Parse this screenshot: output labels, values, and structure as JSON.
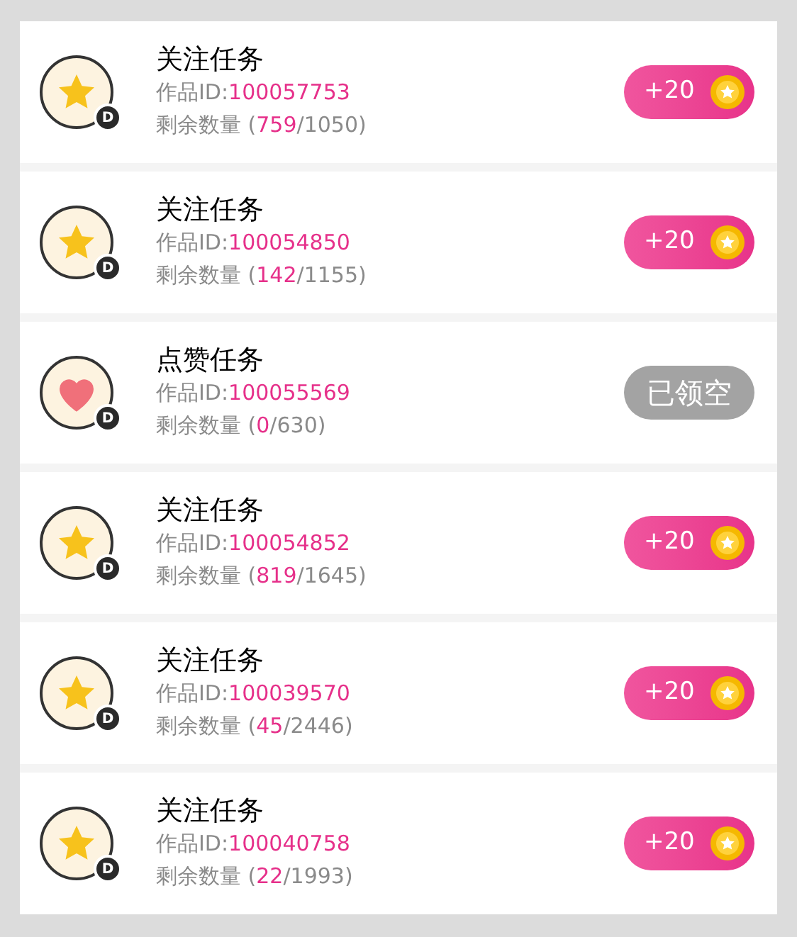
{
  "tasks": [
    {
      "kind": "follow",
      "badge": "D",
      "title": "关注任务",
      "id_label": "作品ID:",
      "id": "100057753",
      "remaining_prefix": "剩余数量 (",
      "remaining": "759",
      "remaining_suffix": "/1050)",
      "action": {
        "kind": "reward",
        "label": "+20"
      }
    },
    {
      "kind": "follow",
      "badge": "D",
      "title": "关注任务",
      "id_label": "作品ID:",
      "id": "100054850",
      "remaining_prefix": "剩余数量 (",
      "remaining": "142",
      "remaining_suffix": "/1155)",
      "action": {
        "kind": "reward",
        "label": "+20"
      }
    },
    {
      "kind": "like",
      "badge": "D",
      "title": "点赞任务",
      "id_label": "作品ID:",
      "id": "100055569",
      "remaining_prefix": "剩余数量 (",
      "remaining": "0",
      "remaining_suffix": "/630)",
      "action": {
        "kind": "empty",
        "label": "已领空"
      }
    },
    {
      "kind": "follow",
      "badge": "D",
      "title": "关注任务",
      "id_label": "作品ID:",
      "id": "100054852",
      "remaining_prefix": "剩余数量 (",
      "remaining": "819",
      "remaining_suffix": "/1645)",
      "action": {
        "kind": "reward",
        "label": "+20"
      }
    },
    {
      "kind": "follow",
      "badge": "D",
      "title": "关注任务",
      "id_label": "作品ID:",
      "id": "100039570",
      "remaining_prefix": "剩余数量 (",
      "remaining": "45",
      "remaining_suffix": "/2446)",
      "action": {
        "kind": "reward",
        "label": "+20"
      }
    },
    {
      "kind": "follow",
      "badge": "D",
      "title": "关注任务",
      "id_label": "作品ID:",
      "id": "100040758",
      "remaining_prefix": "剩余数量 (",
      "remaining": "22",
      "remaining_suffix": "/1993)",
      "action": {
        "kind": "reward",
        "label": "+20"
      }
    }
  ]
}
